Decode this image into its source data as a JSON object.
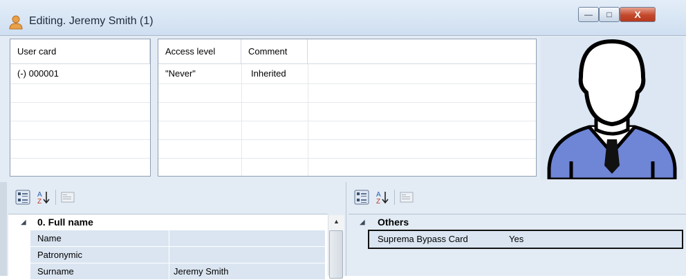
{
  "window": {
    "title": "Editing. Jeremy Smith (1)",
    "controls": {
      "minimize": "—",
      "maximize": "□",
      "close": "X"
    },
    "colors": {
      "close": "#c4482c",
      "accent": "#e3ebf4"
    }
  },
  "user_cards": {
    "header": "User card",
    "rows": [
      "(-) 000001"
    ]
  },
  "access": {
    "headers": [
      "Access level",
      "Comment"
    ],
    "rows": [
      {
        "level": "\"Never\"",
        "comment": "Inherited"
      }
    ]
  },
  "photo": {
    "icon": "user-avatar-icon",
    "color": "#6f85d6"
  },
  "left_panel": {
    "toolbar": [
      "categorized-icon",
      "sort-az-icon",
      "property-pages-icon"
    ],
    "category": "0. Full name",
    "properties": [
      {
        "name": "Name",
        "value": ""
      },
      {
        "name": "Patronymic",
        "value": ""
      },
      {
        "name": "Surname",
        "value": "Jeremy Smith"
      }
    ]
  },
  "right_panel": {
    "toolbar": [
      "categorized-icon",
      "sort-az-icon",
      "property-pages-icon"
    ],
    "category": "Others",
    "properties": [
      {
        "name": "Suprema Bypass Card",
        "value": "Yes"
      }
    ]
  }
}
